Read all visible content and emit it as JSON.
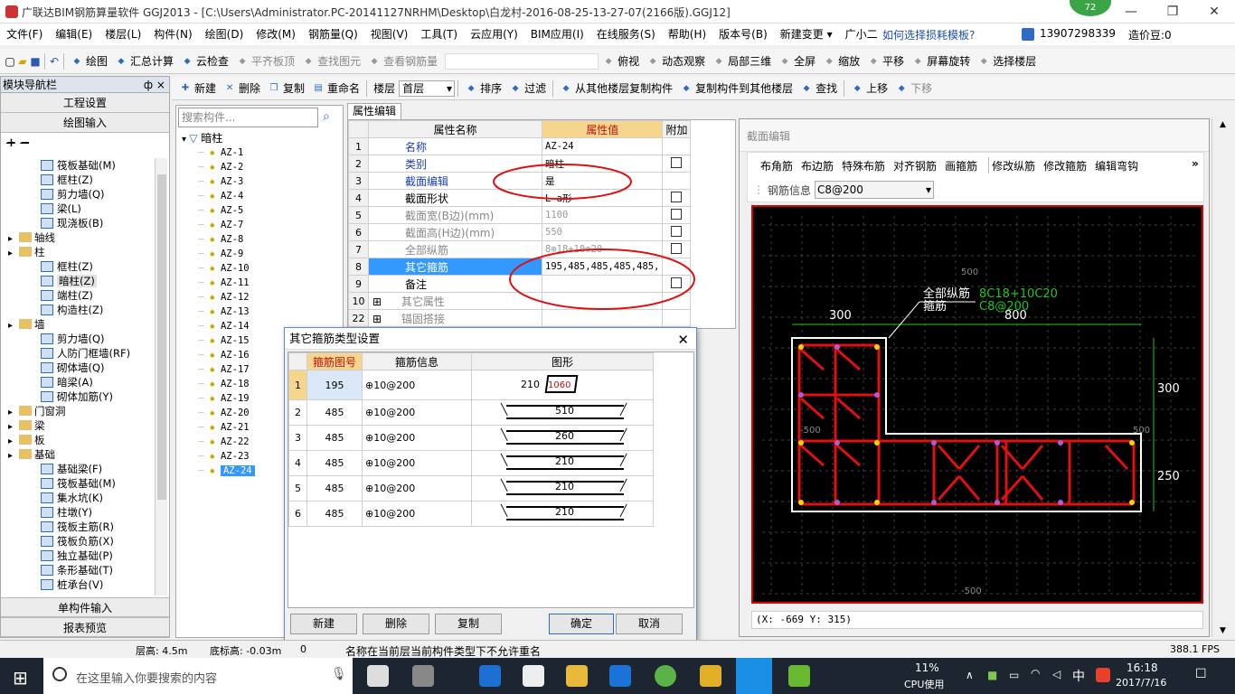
{
  "title": "广联达BIM钢筋算量软件 GGJ2013 - [C:\\Users\\Administrator.PC-20141127NRHM\\Desktop\\白龙村-2016-08-25-13-27-07(2166版).GGJ12]",
  "notification_badge": "72",
  "window_controls": {
    "minimize": "—",
    "maximize": "❐",
    "close": "✕"
  },
  "menu": [
    "文件(F)",
    "编辑(E)",
    "楼层(L)",
    "构件(N)",
    "绘图(D)",
    "修改(M)",
    "钢筋量(Q)",
    "视图(V)",
    "工具(T)",
    "云应用(Y)",
    "BIM应用(I)",
    "在线服务(S)",
    "帮助(H)",
    "版本号(B)",
    "新建变更 ▾",
    "广小二"
  ],
  "menu_right": {
    "help_link": "如何选择损耗模板?",
    "phone": "13907298339",
    "price_bean": "造价豆:0"
  },
  "toolbar1": [
    "绘图",
    "汇总计算",
    "云检查",
    "平齐板顶",
    "查找图元",
    "查看钢筋量",
    "俯视",
    "动态观察",
    "局部三维",
    "全屏",
    "缩放",
    "平移",
    "屏幕旋转",
    "选择楼层"
  ],
  "toolbar2": {
    "items": [
      "新建",
      "删除",
      "复制",
      "重命名"
    ],
    "floor_label": "楼层",
    "floor_value": "首层",
    "items2": [
      "排序",
      "过滤",
      "从其他楼层复制构件",
      "复制构件到其他楼层",
      "查找",
      "上移",
      "下移"
    ]
  },
  "nav": {
    "header": "模块导航栏",
    "pin": "ф ×",
    "top_buttons": [
      "工程设置",
      "绘图输入"
    ],
    "bottom_buttons": [
      "单构件输入",
      "报表预览"
    ],
    "tree": [
      {
        "label": "筏板基础(M)",
        "level": 2
      },
      {
        "label": "框柱(Z)",
        "level": 2
      },
      {
        "label": "剪力墙(Q)",
        "level": 2
      },
      {
        "label": "梁(L)",
        "level": 2
      },
      {
        "label": "现浇板(B)",
        "level": 2
      },
      {
        "label": "轴线",
        "level": 1
      },
      {
        "label": "柱",
        "level": 1
      },
      {
        "label": "框柱(Z)",
        "level": 2
      },
      {
        "label": "暗柱(Z)",
        "level": 2
      },
      {
        "label": "端柱(Z)",
        "level": 2
      },
      {
        "label": "构造柱(Z)",
        "level": 2
      },
      {
        "label": "墙",
        "level": 1
      },
      {
        "label": "剪力墙(Q)",
        "level": 2
      },
      {
        "label": "人防门框墙(RF)",
        "level": 2
      },
      {
        "label": "砌体墙(Q)",
        "level": 2
      },
      {
        "label": "暗梁(A)",
        "level": 2
      },
      {
        "label": "砌体加筋(Y)",
        "level": 2
      },
      {
        "label": "门窗洞",
        "level": 1
      },
      {
        "label": "梁",
        "level": 1
      },
      {
        "label": "板",
        "level": 1
      },
      {
        "label": "基础",
        "level": 1
      },
      {
        "label": "基础梁(F)",
        "level": 2
      },
      {
        "label": "筏板基础(M)",
        "level": 2
      },
      {
        "label": "集水坑(K)",
        "level": 2
      },
      {
        "label": "柱墩(Y)",
        "level": 2
      },
      {
        "label": "筏板主筋(R)",
        "level": 2
      },
      {
        "label": "筏板负筋(X)",
        "level": 2
      },
      {
        "label": "独立基础(P)",
        "level": 2
      },
      {
        "label": "条形基础(T)",
        "level": 2
      },
      {
        "label": "桩承台(V)",
        "level": 2
      }
    ]
  },
  "components": {
    "search_placeholder": "搜索构件...",
    "root": "暗柱",
    "items": [
      "AZ-1",
      "AZ-2",
      "AZ-3",
      "AZ-4",
      "AZ-5",
      "AZ-7",
      "AZ-8",
      "AZ-9",
      "AZ-10",
      "AZ-11",
      "AZ-12",
      "AZ-13",
      "AZ-14",
      "AZ-15",
      "AZ-16",
      "AZ-17",
      "AZ-18",
      "AZ-19",
      "AZ-20",
      "AZ-21",
      "AZ-22",
      "AZ-23",
      "AZ-24"
    ],
    "selected": "AZ-24"
  },
  "props": {
    "tab": "属性编辑",
    "headers": [
      "属性名称",
      "属性值",
      "附加"
    ],
    "rows": [
      {
        "n": "1",
        "name": "名称",
        "value": "AZ-24",
        "check": false,
        "link": true
      },
      {
        "n": "2",
        "name": "类别",
        "value": "暗柱",
        "check": true,
        "link": true
      },
      {
        "n": "3",
        "name": "截面编辑",
        "value": "是",
        "check": false,
        "link": true
      },
      {
        "n": "4",
        "name": "截面形状",
        "value": "L-a形",
        "check": true,
        "link": false
      },
      {
        "n": "5",
        "name": "截面宽(B边)(mm)",
        "value": "1100",
        "check": true,
        "grey": true
      },
      {
        "n": "6",
        "name": "截面高(H边)(mm)",
        "value": "550",
        "check": true,
        "grey": true
      },
      {
        "n": "7",
        "name": "全部纵筋",
        "value": "8⊕18+10⊕20",
        "check": true,
        "grey": true
      },
      {
        "n": "8",
        "name": "其它箍筋",
        "value": "195,485,485,485,485,",
        "check": false,
        "selected": true
      },
      {
        "n": "9",
        "name": "备注",
        "value": "",
        "check": true
      },
      {
        "n": "10",
        "name": "其它属性",
        "value": "",
        "check": false,
        "expand": true
      },
      {
        "n": "22",
        "name": "锚固搭接",
        "value": "",
        "check": false,
        "expand": true
      }
    ]
  },
  "section": {
    "title": "截面编辑",
    "toolbar": [
      "布角筋",
      "布边筋",
      "特殊布筋",
      "对齐钢筋",
      "画箍筋",
      "修改纵筋",
      "修改箍筋",
      "编辑弯钩"
    ],
    "rebar_label": "钢筋信息",
    "rebar_value": "C8@200",
    "dim_300_top": "300",
    "dim_800": "800",
    "dim_300_right": "300",
    "dim_250": "250",
    "label_all": "全部纵筋",
    "label_stirrup": "箍筋",
    "val_all": "8C18+10C20",
    "val_stirrup": "C8@200",
    "grid_labels": [
      "500",
      "-500",
      "500",
      "-500"
    ],
    "coords": "(X: -669 Y: 315)"
  },
  "dialog": {
    "title": "其它箍筋类型设置",
    "headers": [
      "箍筋图号",
      "箍筋信息",
      "图形"
    ],
    "rows": [
      {
        "n": "1",
        "code": "195",
        "info": "⊕10@200",
        "shape": "box",
        "a": "210",
        "b": "1060"
      },
      {
        "n": "2",
        "code": "485",
        "info": "⊕10@200",
        "shape": "bar",
        "a": "510"
      },
      {
        "n": "3",
        "code": "485",
        "info": "⊕10@200",
        "shape": "bar",
        "a": "260"
      },
      {
        "n": "4",
        "code": "485",
        "info": "⊕10@200",
        "shape": "bar",
        "a": "210"
      },
      {
        "n": "5",
        "code": "485",
        "info": "⊕10@200",
        "shape": "bar",
        "a": "210"
      },
      {
        "n": "6",
        "code": "485",
        "info": "⊕10@200",
        "shape": "bar",
        "a": "210"
      }
    ],
    "buttons": {
      "new": "新建",
      "delete": "删除",
      "copy": "复制",
      "ok": "确定",
      "cancel": "取消"
    }
  },
  "status": {
    "floor_height": "层高: 4.5m",
    "bottom_height": "底标高: -0.03m",
    "zero": "0",
    "message": "名称在当前层当前构件类型下不允许重名",
    "fps": "388.1 FPS"
  },
  "taskbar": {
    "search": "在这里输入你要搜索的内容",
    "cpu_pct": "11%",
    "cpu_label": "CPU使用",
    "ime": "中",
    "time": "16:18",
    "date": "2017/7/16"
  },
  "colors": {
    "rebar": "#e01010",
    "dim": "#1ec81e",
    "canvas": "#000000",
    "selection": "#3399ff",
    "prop_header": "#f6d68c"
  }
}
